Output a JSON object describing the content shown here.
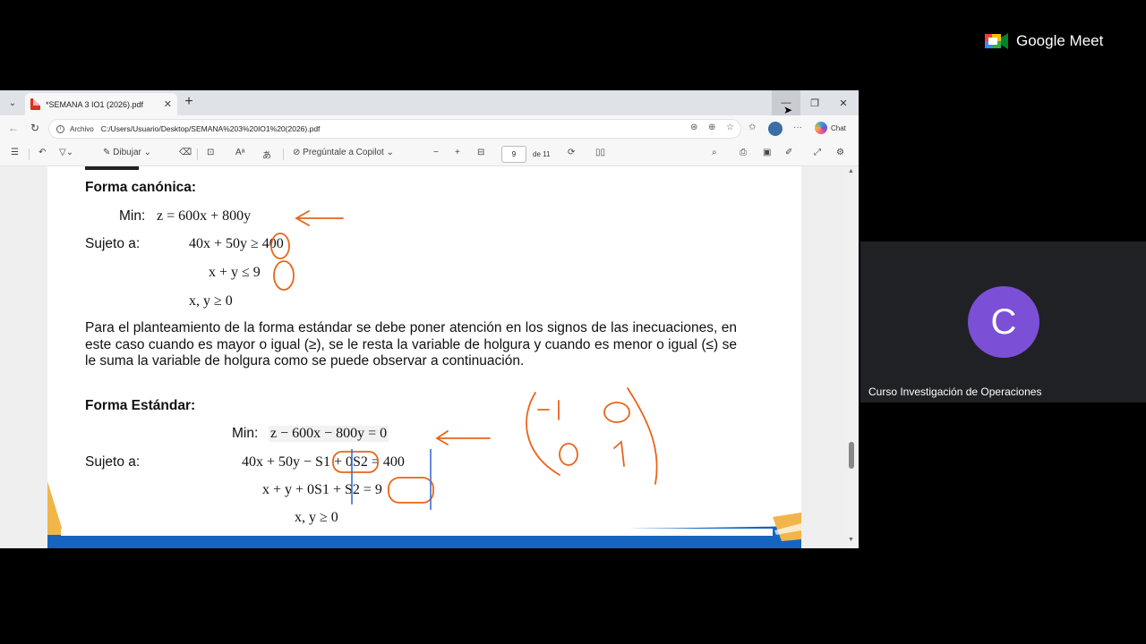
{
  "browser": {
    "tab_title": "*SEMANA 3 IO1 (2026).pdf",
    "tab_close": "✕",
    "new_tab": "+",
    "tab_menu": "⌄",
    "window_buttons": {
      "minimize": "—",
      "restore": "❐",
      "close": "✕"
    },
    "address": {
      "scheme_label": "Archivo",
      "url": "C:/Users/Usuario/Desktop/SEMANA%203%20IO1%20(2026).pdf",
      "chat_label": "Chat"
    }
  },
  "pdf_toolbar": {
    "draw_label": "Dibujar",
    "copilot_label": "Pregúntale a Copilot",
    "page_current": "9",
    "page_total_label": "de 11",
    "zoom_out": "−",
    "zoom_in": "+"
  },
  "document": {
    "canonical_heading": "Forma canónica:",
    "min_label": "Min:",
    "canonical_objective": "z = 600x + 800y",
    "subject_label": "Sujeto a:",
    "c1": "40x + 50y ≥ 400",
    "c2": "x +  y ≤ 9",
    "c3": "x, y ≥ 0",
    "paragraph": "Para el planteamiento de la forma estándar se debe poner atención en los signos de las inecuaciones, en este caso cuando es mayor o igual (≥), se le resta la variable de holgura y cuando es menor o igual (≤) se le suma la variable de holgura como se puede observar a continuación.",
    "standard_heading": "Forma Estándar:",
    "standard_objective": "z − 600x − 800y = 0",
    "s1": "40x +  50y − S1 + 0S2 =  400",
    "s2": "x +     y + 0S1 + S2 =     9",
    "s3": "x, y ≥ 0"
  },
  "meet": {
    "brand": "Google Meet",
    "participant_initial": "C",
    "participant_name": "Curso Investigación de Operaciones",
    "avatar_color": "#7b4fd6"
  },
  "annotation_color": "#e8651a",
  "bracket_color": "#3b6fd6"
}
